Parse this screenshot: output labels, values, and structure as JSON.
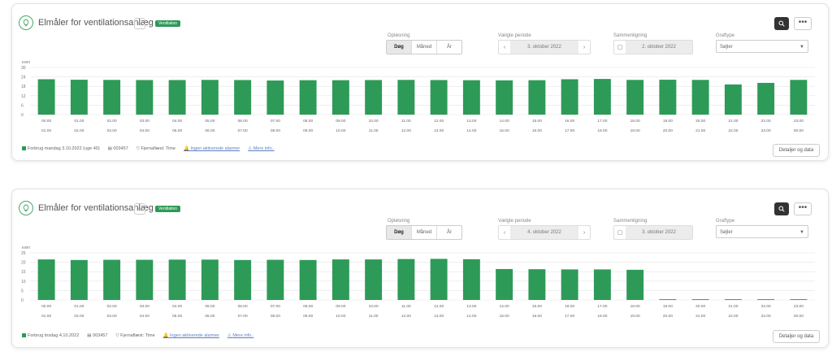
{
  "colors": {
    "bar": "#2e9a58",
    "grid": "#e6e6e6",
    "accent": "#2e9a58"
  },
  "cards": [
    {
      "title": "Elmåler for ventilationsanlæg",
      "badge": "Ventilation",
      "opl_label": "Opløsning",
      "res_options": [
        "Døg",
        "Måned",
        "År"
      ],
      "active_res": "Døg",
      "period_label": "Vælgte periode",
      "period_value": "3. oktober 2022",
      "compare_label": "Sammenligning",
      "compare_value": "2. oktober 2022",
      "gtype_label": "Graftype",
      "gtype_value": "Søjler",
      "legend_text": "Forbrug mandag 3.10.2022 (uge 40)",
      "meter_id": "003457",
      "remote_read": "Fjernaflæst: Time",
      "alarms": "Ingen aktiverede alarmer",
      "more_info": "Mere info..",
      "details_btn": "Detaljer og data",
      "chart_data": {
        "type": "bar",
        "ylabel": "kWh",
        "ylim": [
          0,
          30
        ],
        "yticks": [
          0,
          6,
          12,
          18,
          24,
          30
        ],
        "categories_start": [
          "00.00",
          "01.00",
          "02.00",
          "03.00",
          "04.00",
          "05.00",
          "06.00",
          "07.00",
          "08.00",
          "09.00",
          "10.00",
          "11.00",
          "12.00",
          "13.00",
          "14.00",
          "15.00",
          "16.00",
          "17.00",
          "18.00",
          "19.00",
          "20.00",
          "21.00",
          "22.00",
          "23.00"
        ],
        "categories_end": [
          "01.00",
          "02.00",
          "03.00",
          "04.00",
          "05.00",
          "06.00",
          "07.00",
          "08.00",
          "09.00",
          "10.00",
          "11.00",
          "12.00",
          "13.00",
          "14.00",
          "15.00",
          "16.00",
          "17.00",
          "18.00",
          "19.00",
          "20.00",
          "21.00",
          "22.00",
          "23.00",
          "00.00"
        ],
        "values": [
          22.5,
          22.2,
          22.1,
          22.0,
          22.0,
          22.1,
          22.0,
          21.7,
          21.9,
          21.9,
          22.0,
          22.1,
          22.0,
          21.9,
          21.8,
          21.9,
          22.5,
          22.7,
          22.1,
          22.2,
          22.1,
          19.2,
          20.2,
          22.1
        ],
        "grid": true
      }
    },
    {
      "title": "Elmåler for ventilationsanlæg",
      "badge": "Ventilation",
      "opl_label": "Opløsning",
      "res_options": [
        "Døg",
        "Måned",
        "År"
      ],
      "active_res": "Døg",
      "period_label": "Vælgte periode",
      "period_value": "4. oktober 2022",
      "compare_label": "Sammenligning",
      "compare_value": "3. oktober 2022",
      "gtype_label": "Graftype",
      "gtype_value": "Søjler",
      "legend_text": "Forbrug tirsdag 4.10.2022",
      "meter_id": "003457",
      "remote_read": "Fjernaflæst: Time",
      "alarms": "Ingen aktiverede alarmer",
      "more_info": "Mere info..",
      "details_btn": "Detaljer og data",
      "chart_data": {
        "type": "bar",
        "ylabel": "kWh",
        "ylim": [
          0,
          25
        ],
        "yticks": [
          0,
          5,
          10,
          15,
          20,
          25
        ],
        "categories_start": [
          "00.00",
          "01.00",
          "02.00",
          "03.00",
          "04.00",
          "05.00",
          "06.00",
          "07.00",
          "08.00",
          "09.00",
          "10.00",
          "11.00",
          "12.00",
          "13.00",
          "14.00",
          "15.00",
          "16.00",
          "17.00",
          "18.00",
          "19.00",
          "20.00",
          "21.00",
          "22.00",
          "23.00"
        ],
        "categories_end": [
          "01.00",
          "02.00",
          "03.00",
          "04.00",
          "05.00",
          "06.00",
          "07.00",
          "08.00",
          "09.00",
          "10.00",
          "11.00",
          "12.00",
          "13.00",
          "14.00",
          "15.00",
          "16.00",
          "17.00",
          "18.00",
          "19.00",
          "20.00",
          "21.00",
          "22.00",
          "23.00",
          "00.00"
        ],
        "values": [
          21.5,
          21.2,
          21.3,
          21.3,
          21.4,
          21.4,
          21.2,
          21.3,
          21.2,
          21.5,
          21.5,
          21.7,
          21.8,
          21.6,
          16.4,
          16.3,
          16.2,
          16.2,
          16.0,
          0.4,
          0.4,
          0.4,
          0.4,
          0.4,
          0.4
        ],
        "grid": true
      }
    }
  ]
}
